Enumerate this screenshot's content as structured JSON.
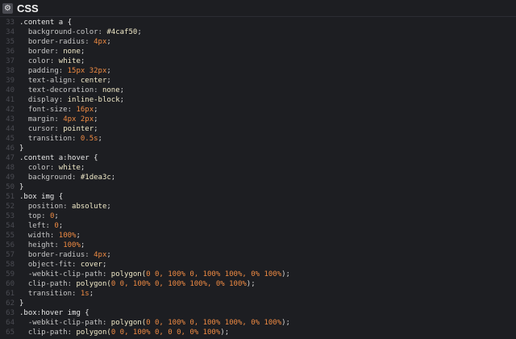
{
  "header": {
    "title": "CSS",
    "icon": "gear-icon"
  },
  "code_lines": [
    {
      "n": "33",
      "parts": [
        {
          "t": ".content a {",
          "c": "sel"
        }
      ]
    },
    {
      "n": "34",
      "parts": [
        {
          "t": "  background-color: ",
          "c": "prop"
        },
        {
          "t": "#4caf50",
          "c": "val"
        },
        {
          "t": ";",
          "c": "punc"
        }
      ]
    },
    {
      "n": "35",
      "parts": [
        {
          "t": "  border-radius: ",
          "c": "prop"
        },
        {
          "t": "4px",
          "c": "num"
        },
        {
          "t": ";",
          "c": "punc"
        }
      ]
    },
    {
      "n": "36",
      "parts": [
        {
          "t": "  border: ",
          "c": "prop"
        },
        {
          "t": "none",
          "c": "val"
        },
        {
          "t": ";",
          "c": "punc"
        }
      ]
    },
    {
      "n": "37",
      "parts": [
        {
          "t": "  color: ",
          "c": "prop"
        },
        {
          "t": "white",
          "c": "val"
        },
        {
          "t": ";",
          "c": "punc"
        }
      ]
    },
    {
      "n": "38",
      "parts": [
        {
          "t": "  padding: ",
          "c": "prop"
        },
        {
          "t": "15px 32px",
          "c": "num"
        },
        {
          "t": ";",
          "c": "punc"
        }
      ]
    },
    {
      "n": "39",
      "parts": [
        {
          "t": "  text-align: ",
          "c": "prop"
        },
        {
          "t": "center",
          "c": "val"
        },
        {
          "t": ";",
          "c": "punc"
        }
      ]
    },
    {
      "n": "40",
      "parts": [
        {
          "t": "  text-decoration: ",
          "c": "prop"
        },
        {
          "t": "none",
          "c": "val"
        },
        {
          "t": ";",
          "c": "punc"
        }
      ]
    },
    {
      "n": "41",
      "parts": [
        {
          "t": "  display: ",
          "c": "prop"
        },
        {
          "t": "inline-block",
          "c": "val"
        },
        {
          "t": ";",
          "c": "punc"
        }
      ]
    },
    {
      "n": "42",
      "parts": [
        {
          "t": "  font-size: ",
          "c": "prop"
        },
        {
          "t": "16px",
          "c": "num"
        },
        {
          "t": ";",
          "c": "punc"
        }
      ]
    },
    {
      "n": "43",
      "parts": [
        {
          "t": "  margin: ",
          "c": "prop"
        },
        {
          "t": "4px 2px",
          "c": "num"
        },
        {
          "t": ";",
          "c": "punc"
        }
      ]
    },
    {
      "n": "44",
      "parts": [
        {
          "t": "  cursor: ",
          "c": "prop"
        },
        {
          "t": "pointer",
          "c": "val"
        },
        {
          "t": ";",
          "c": "punc"
        }
      ]
    },
    {
      "n": "45",
      "parts": [
        {
          "t": "  transition: ",
          "c": "prop"
        },
        {
          "t": "0.5s",
          "c": "num"
        },
        {
          "t": ";",
          "c": "punc"
        }
      ]
    },
    {
      "n": "46",
      "parts": [
        {
          "t": "}",
          "c": "sel"
        }
      ]
    },
    {
      "n": "47",
      "parts": [
        {
          "t": ".content a:hover {",
          "c": "sel"
        }
      ]
    },
    {
      "n": "48",
      "parts": [
        {
          "t": "  color: ",
          "c": "prop"
        },
        {
          "t": "white",
          "c": "val"
        },
        {
          "t": ";",
          "c": "punc"
        }
      ]
    },
    {
      "n": "49",
      "parts": [
        {
          "t": "  background: ",
          "c": "prop"
        },
        {
          "t": "#1dea3c",
          "c": "val"
        },
        {
          "t": ";",
          "c": "punc"
        }
      ]
    },
    {
      "n": "50",
      "parts": [
        {
          "t": "}",
          "c": "sel"
        }
      ]
    },
    {
      "n": "51",
      "parts": [
        {
          "t": ".box img {",
          "c": "sel"
        }
      ]
    },
    {
      "n": "52",
      "parts": [
        {
          "t": "  position: ",
          "c": "prop"
        },
        {
          "t": "absolute",
          "c": "val"
        },
        {
          "t": ";",
          "c": "punc"
        }
      ]
    },
    {
      "n": "53",
      "parts": [
        {
          "t": "  top: ",
          "c": "prop"
        },
        {
          "t": "0",
          "c": "num"
        },
        {
          "t": ";",
          "c": "punc"
        }
      ]
    },
    {
      "n": "54",
      "parts": [
        {
          "t": "  left: ",
          "c": "prop"
        },
        {
          "t": "0",
          "c": "num"
        },
        {
          "t": ";",
          "c": "punc"
        }
      ]
    },
    {
      "n": "55",
      "parts": [
        {
          "t": "  width: ",
          "c": "prop"
        },
        {
          "t": "100%",
          "c": "num"
        },
        {
          "t": ";",
          "c": "punc"
        }
      ]
    },
    {
      "n": "56",
      "parts": [
        {
          "t": "  height: ",
          "c": "prop"
        },
        {
          "t": "100%",
          "c": "num"
        },
        {
          "t": ";",
          "c": "punc"
        }
      ]
    },
    {
      "n": "57",
      "parts": [
        {
          "t": "  border-radius: ",
          "c": "prop"
        },
        {
          "t": "4px",
          "c": "num"
        },
        {
          "t": ";",
          "c": "punc"
        }
      ]
    },
    {
      "n": "58",
      "parts": [
        {
          "t": "  object-fit: ",
          "c": "prop"
        },
        {
          "t": "cover",
          "c": "val"
        },
        {
          "t": ";",
          "c": "punc"
        }
      ]
    },
    {
      "n": "59",
      "parts": [
        {
          "t": "  -webkit-clip-path: ",
          "c": "prop"
        },
        {
          "t": "polygon(",
          "c": "val"
        },
        {
          "t": "0 0, 100% 0, 100% 100%, 0% 100%",
          "c": "num"
        },
        {
          "t": ");",
          "c": "punc"
        }
      ]
    },
    {
      "n": "60",
      "parts": [
        {
          "t": "  clip-path: ",
          "c": "prop"
        },
        {
          "t": "polygon(",
          "c": "val"
        },
        {
          "t": "0 0, 100% 0, 100% 100%, 0% 100%",
          "c": "num"
        },
        {
          "t": ");",
          "c": "punc"
        }
      ]
    },
    {
      "n": "61",
      "parts": [
        {
          "t": "  transition: ",
          "c": "prop"
        },
        {
          "t": "1s",
          "c": "num"
        },
        {
          "t": ";",
          "c": "punc"
        }
      ]
    },
    {
      "n": "62",
      "parts": [
        {
          "t": "}",
          "c": "sel"
        }
      ]
    },
    {
      "n": "63",
      "parts": [
        {
          "t": ".box:hover img {",
          "c": "sel"
        }
      ]
    },
    {
      "n": "64",
      "parts": [
        {
          "t": "  -webkit-clip-path: ",
          "c": "prop"
        },
        {
          "t": "polygon(",
          "c": "val"
        },
        {
          "t": "0 0, 100% 0, 100% 100%, 0% 100%",
          "c": "num"
        },
        {
          "t": ");",
          "c": "punc"
        }
      ]
    },
    {
      "n": "65",
      "parts": [
        {
          "t": "  clip-path: ",
          "c": "prop"
        },
        {
          "t": "polygon(",
          "c": "val"
        },
        {
          "t": "0 0, 100% 0, 0 0, 0% 100%",
          "c": "num"
        },
        {
          "t": ");",
          "c": "punc"
        }
      ]
    }
  ]
}
